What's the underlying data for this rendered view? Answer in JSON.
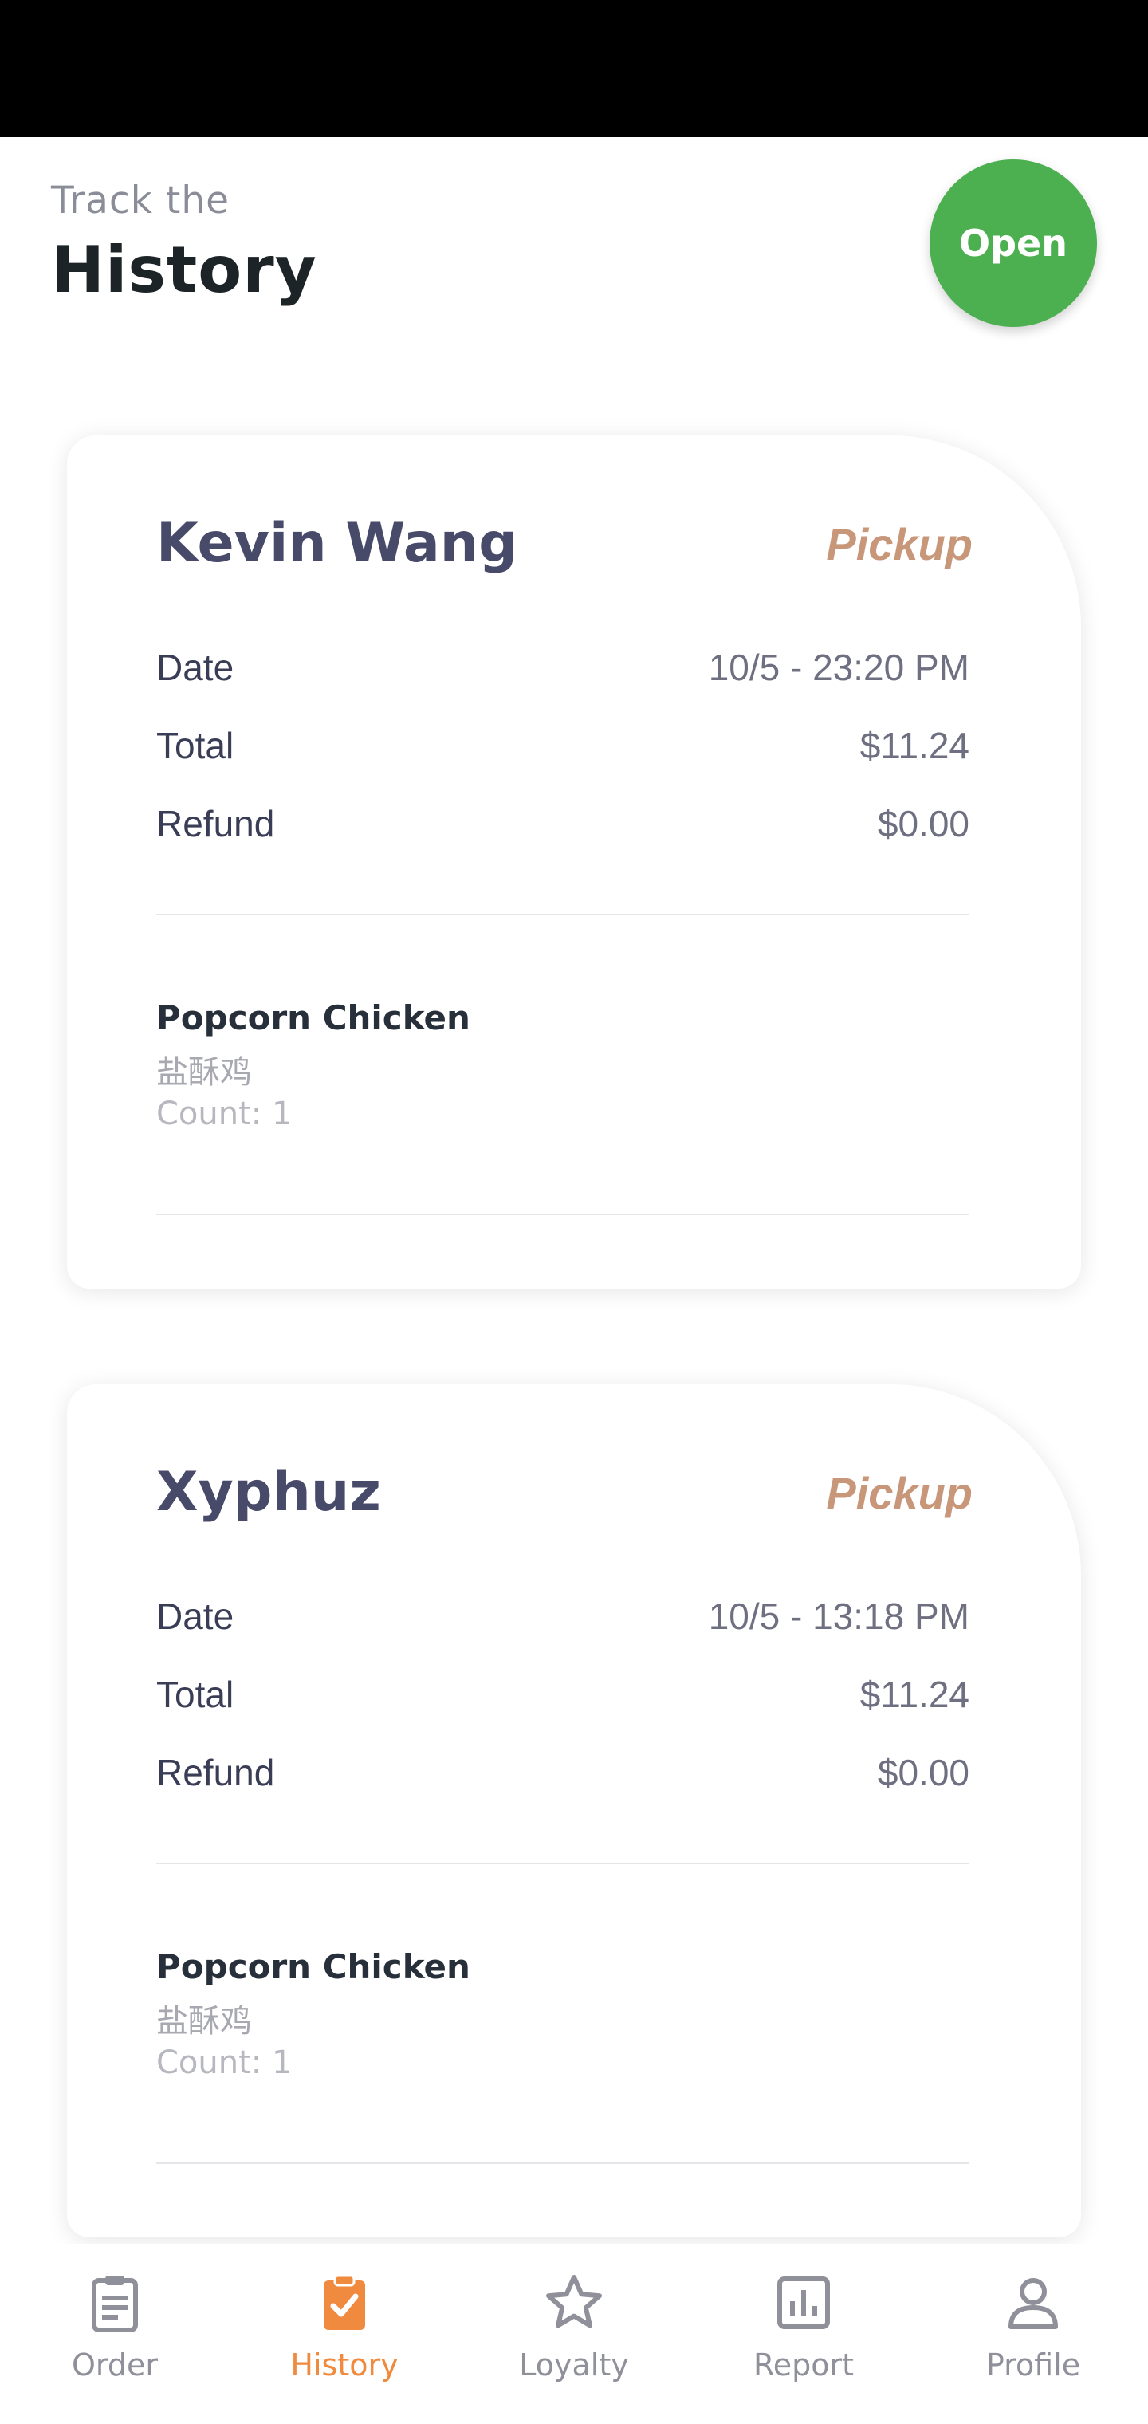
{
  "header": {
    "subtitle": "Track the",
    "title": "History",
    "open_button": "Open"
  },
  "orders": [
    {
      "customer": "Kevin Wang",
      "type": "Pickup",
      "date_label": "Date",
      "date": "10/5 - 23:20 PM",
      "total_label": "Total",
      "total": "$11.24",
      "refund_label": "Refund",
      "refund": "$0.00",
      "items": [
        {
          "name": "Popcorn Chicken",
          "name_cn": "盐酥鸡",
          "count": "Count: 1"
        }
      ]
    },
    {
      "customer": "Xyphuz",
      "type": "Pickup",
      "date_label": "Date",
      "date": "10/5 - 13:18 PM",
      "total_label": "Total",
      "total": "$11.24",
      "refund_label": "Refund",
      "refund": "$0.00",
      "items": [
        {
          "name": "Popcorn Chicken",
          "name_cn": "盐酥鸡",
          "count": "Count: 1"
        }
      ]
    }
  ],
  "nav": {
    "items": [
      {
        "label": "Order",
        "icon": "clipboard-list-icon",
        "active": false
      },
      {
        "label": "History",
        "icon": "clipboard-check-icon",
        "active": true
      },
      {
        "label": "Loyalty",
        "icon": "star-icon",
        "active": false
      },
      {
        "label": "Report",
        "icon": "bar-chart-icon",
        "active": false
      },
      {
        "label": "Profile",
        "icon": "user-icon",
        "active": false
      }
    ]
  },
  "colors": {
    "open_button": "#4caf50",
    "accent_active": "#ef8a3e",
    "pickup": "#c8977a",
    "customer_name": "#484a6a",
    "nav_inactive": "#8f909a"
  }
}
